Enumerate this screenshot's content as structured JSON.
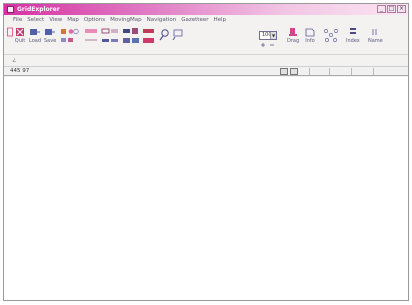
{
  "window": {
    "title": "GridExplorer"
  },
  "menu": [
    "File",
    "Select",
    "View",
    "Map",
    "Options",
    "MovingMap",
    "Navigation",
    "Gazetteer",
    "Help"
  ],
  "toolbar": {
    "quit": "Quit",
    "load": "Load",
    "save": "Save",
    "drag": "Drag",
    "info": "Info",
    "index": "Index",
    "name": "Name",
    "zoom_value": "100"
  },
  "status": {
    "coords": "445 97"
  },
  "colors": {
    "titlebar": "#d630a2",
    "menu_text": "#5a5a72",
    "canvas": "#ffffff"
  }
}
